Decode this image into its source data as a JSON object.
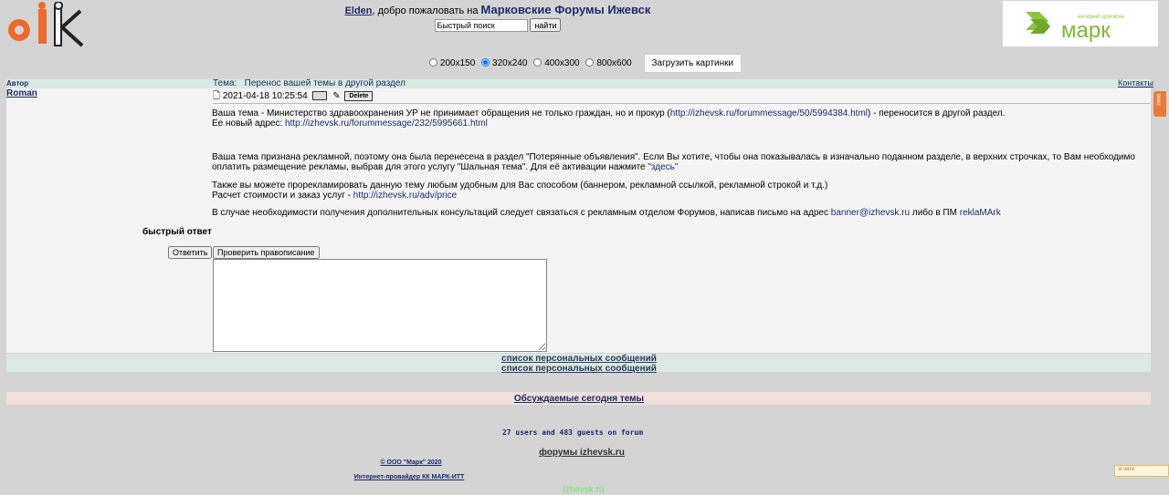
{
  "colors": {
    "background": "#d4d4d4",
    "header_bar": "#dbe9e5",
    "post_bg": "#f4f4f4",
    "today_bar": "#f0dfda",
    "logo_orange": "#ee6a2a",
    "mark_green": "#8cc63f",
    "link_navy": "#1a2a6a"
  },
  "header": {
    "user": "Elden",
    "welcome_text": ", добро пожаловать на ",
    "forum_name": "Марковские Форумы Ижевск",
    "search_placeholder": "Быстрый поиск",
    "search_button": "найти",
    "banner": {
      "tagline": "интернет для всех",
      "brand": "марк"
    }
  },
  "image_sizes": {
    "options": [
      "200x150",
      "320x240",
      "400x300",
      "800x600"
    ],
    "selected": "320x240",
    "load_button": "Загрузить картинки"
  },
  "topic": {
    "author_col": "Автор",
    "label": "Тема:",
    "title": "Перенос вашей темы в другой раздел",
    "contacts": "Контакты"
  },
  "post": {
    "author": "Roman",
    "datetime": "2021-04-18 10:25:54",
    "delete": "Delete",
    "p1_a": "Ваша тема - Министерство здравоохранения УР не принимает обращения не только граждан, но и прокур (",
    "p1_link": "http://izhevsk.ru/forummessage/50/5994384.html",
    "p1_b": ") - переносится в другой раздел.",
    "p2_a": "Ее новый адрес: ",
    "p2_link": "http://izhevsk.ru/forummessage/232/5995661.html",
    "p3": "Ваша тема признана рекламной, поэтому она была перенесена в раздел \"Потерянные объявления\". Если Вы хотите, чтобы она показывалась в изначально поданном разделе, в верхних строчках, то Вам необходимо",
    "p4_a": "оплатить размещение рекламы, выбрав для этого услугу \"Шальная тема\". Для её активации нажмите ",
    "p4_link": "\"здесь\"",
    "p5": "Также вы можете прорекламировать данную тему любым удобным для Вас способом (баннером, рекламной ссылкой, рекламной строкой и т.д.)",
    "p6_a": "Расчет стоимости и заказ услуг - ",
    "p6_link": "http://izhevsk.ru/adv/price",
    "p7_a": "В случае необходимости получения дополнительных консультаций следует связаться с рекламным отделом Форумов, написав письмо на адрес ",
    "p7_email": "banner@izhevsk.ru",
    "p7_b": " либо в ПМ ",
    "p7_pm": "reklaMArk"
  },
  "reply": {
    "title": "быстрый ответ",
    "reply_button": "Ответить",
    "spell_button": "Проверить правописание"
  },
  "pm_links": [
    "список персональных сообщений",
    "список персональных сообщений"
  ],
  "today_topics": "Обсуждаемые сегодня темы",
  "online": "27 users and 483 guests on forum",
  "footer": {
    "forums": "форумы izhevsk.ru",
    "copyright": "© ООО \"Марк\" 2020",
    "provider": "Интернет-провайдер КК МАРК-ИТТ",
    "site": "izhevsk.ru"
  },
  "side_tab": "вниз",
  "corner_widget": "в чате"
}
